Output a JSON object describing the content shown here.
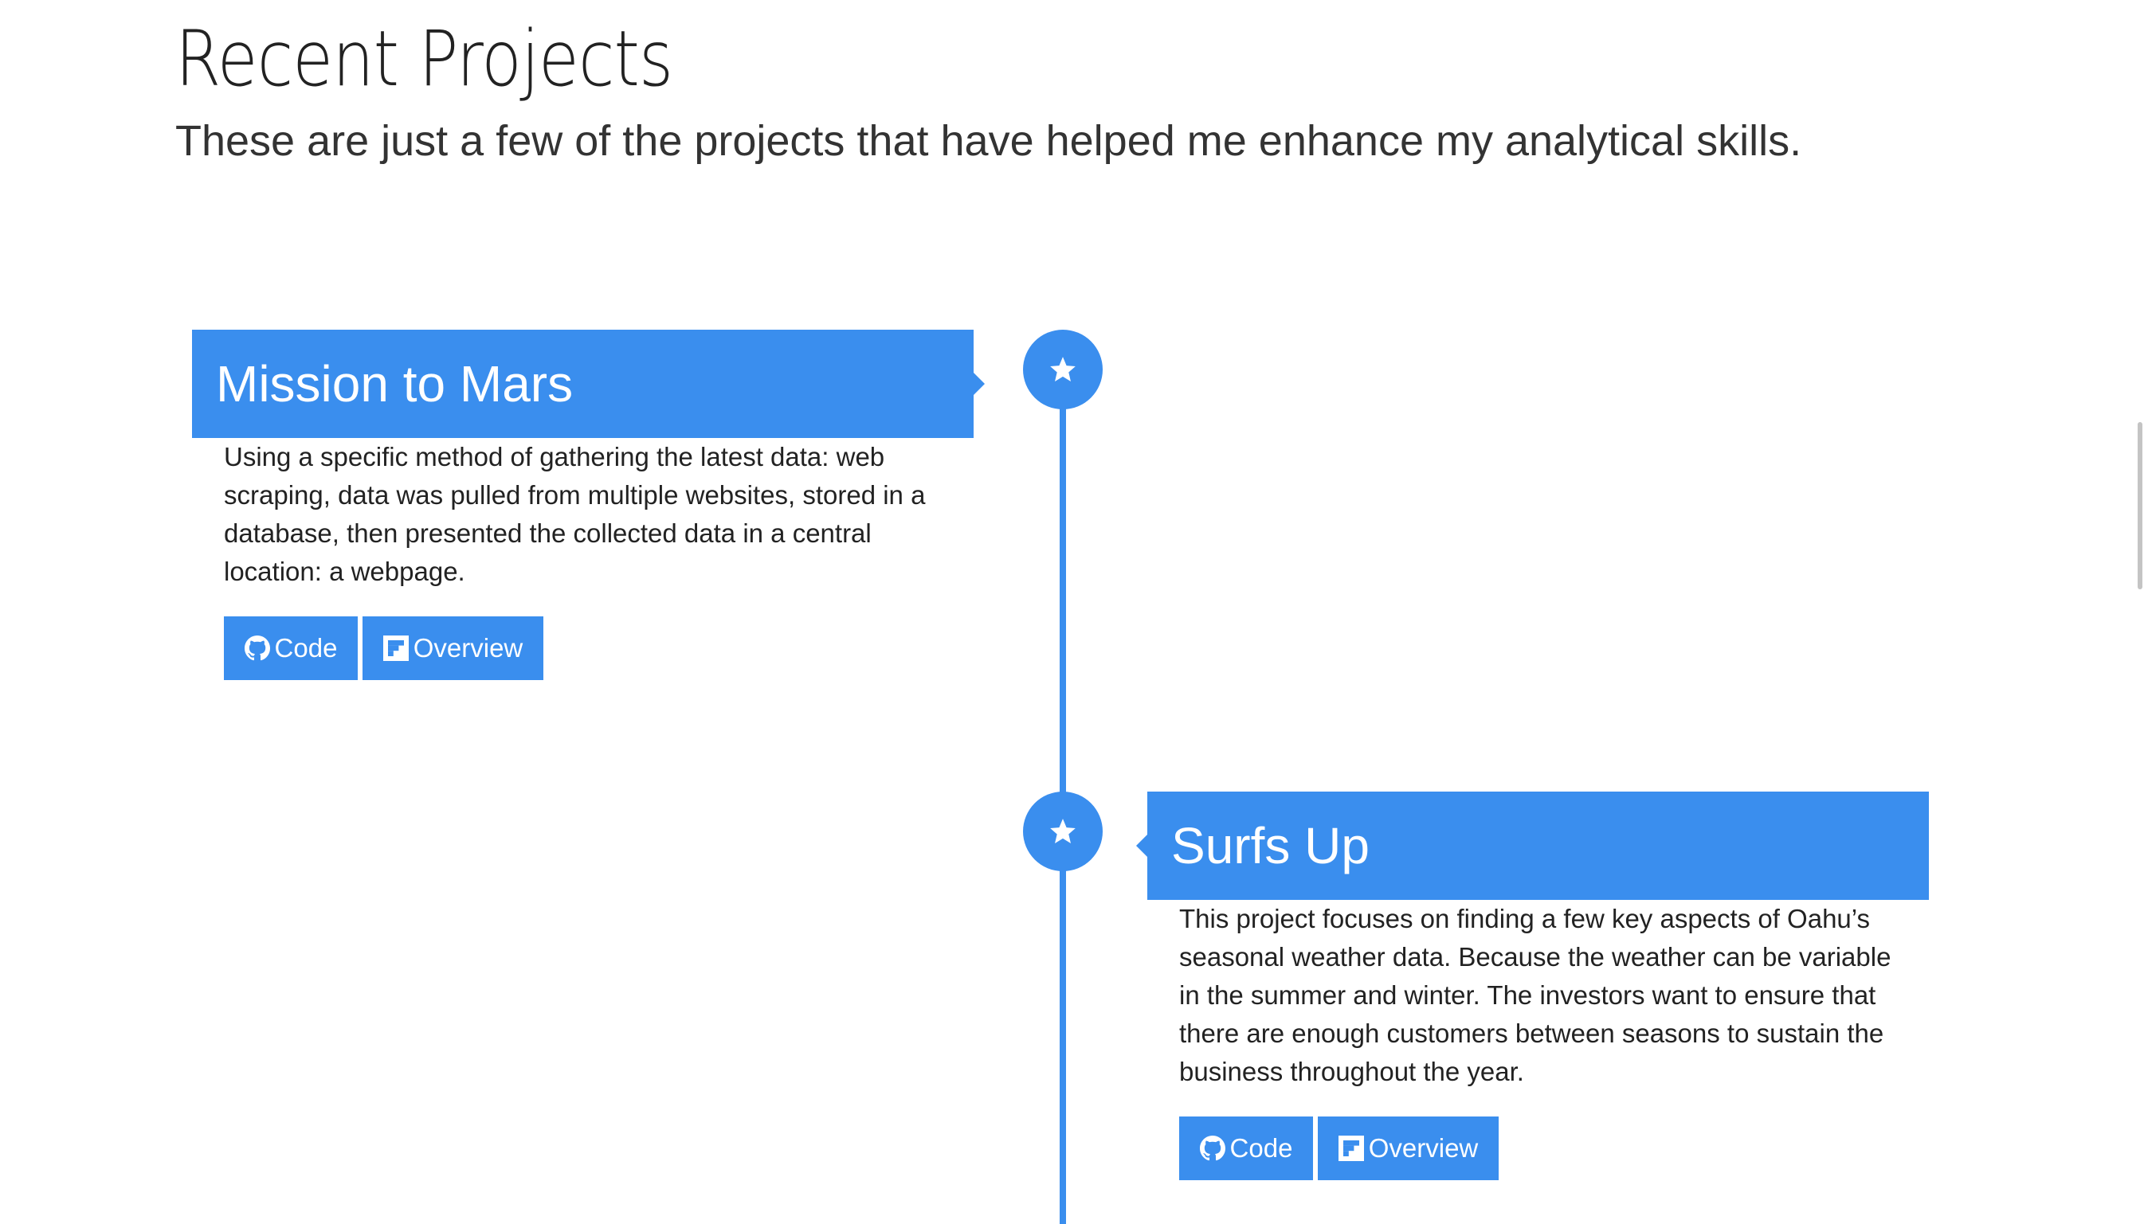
{
  "header": {
    "title": "Recent Projects",
    "subtitle": "These are just a few of the projects that have helped me enhance my analytical skills."
  },
  "projects": [
    {
      "title": "Mission to Mars",
      "description": "Using a specific method of gathering the latest data: web scraping, data was pulled from multiple websites, stored in a database, then presented the collected data in a central location: a webpage.",
      "code_label": "Code",
      "overview_label": "Overview",
      "badge_icon": "star-icon"
    },
    {
      "title": "Surfs Up",
      "description": "This project focuses on finding a few key aspects of Oahu’s seasonal weather data. Because the weather can be variable in the summer and winter. The investors want to ensure that there are enough customers between seasons to sustain the business throughout the year.",
      "code_label": "Code",
      "overview_label": "Overview",
      "badge_icon": "star-icon"
    }
  ],
  "colors": {
    "accent": "#3a8eee",
    "text": "#222222",
    "background": "#ffffff"
  }
}
